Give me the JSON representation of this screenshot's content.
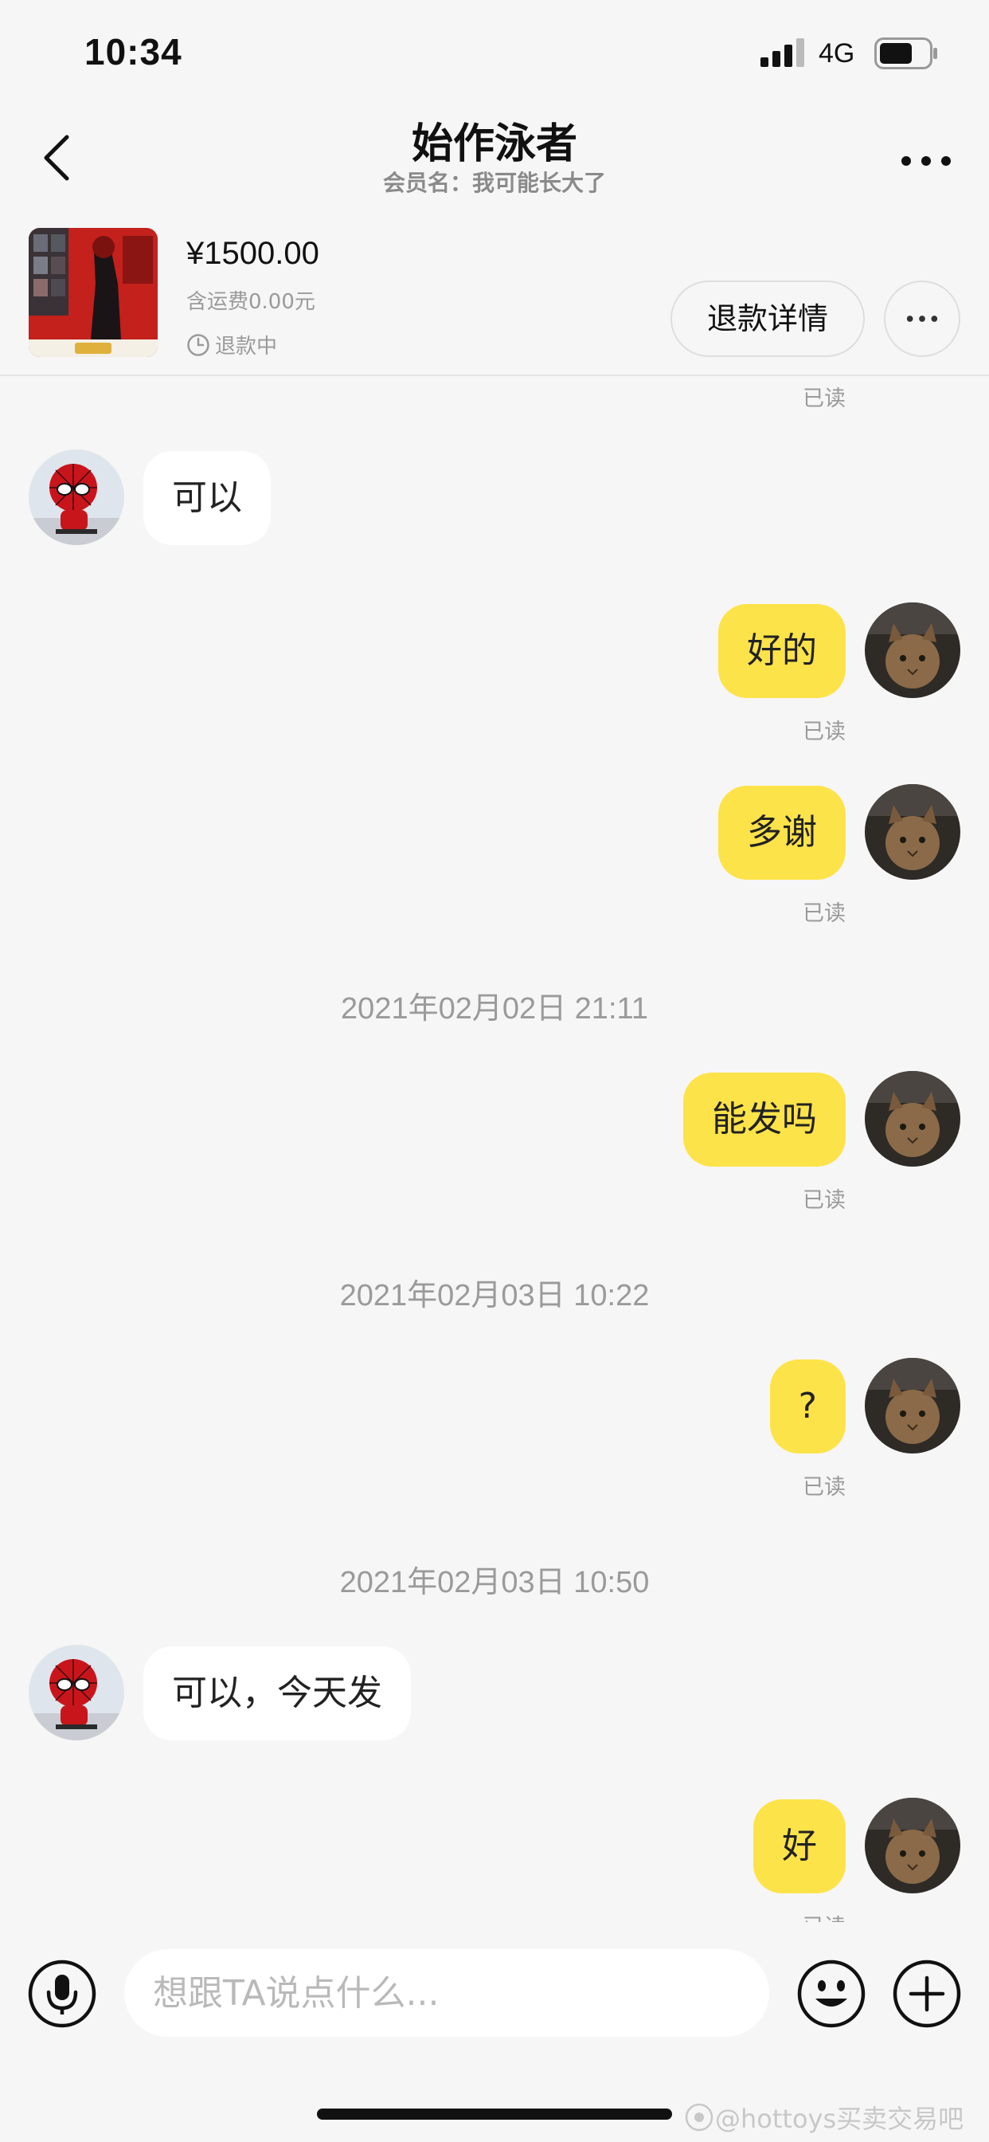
{
  "status_bar": {
    "time": "10:34",
    "network": "4G"
  },
  "nav": {
    "title": "始作泳者",
    "subtitle": "会员名：我可能长大了"
  },
  "order": {
    "price": "¥1500.00",
    "shipping": "含运费0.00元",
    "status": "退款中",
    "refund_button": "退款详情"
  },
  "chat": {
    "read_text": "已读",
    "messages": [
      {
        "side": "in",
        "text": "可以"
      },
      {
        "side": "out",
        "text": "好的"
      },
      {
        "side": "out",
        "text": "多谢"
      },
      {
        "side": "time",
        "text": "2021年02月02日 21:11"
      },
      {
        "side": "out",
        "text": "能发吗"
      },
      {
        "side": "time",
        "text": "2021年02月03日 10:22"
      },
      {
        "side": "out",
        "text": "?"
      },
      {
        "side": "time",
        "text": "2021年02月03日 10:50"
      },
      {
        "side": "in",
        "text": "可以，今天发"
      },
      {
        "side": "out",
        "text": "好"
      }
    ]
  },
  "input": {
    "placeholder": "想跟TA说点什么..."
  },
  "watermark": "@hottoys买卖交易吧",
  "colors": {
    "outgoing_bubble": "#fde34a",
    "incoming_bubble": "#ffffff",
    "background": "#f6f6f6"
  }
}
